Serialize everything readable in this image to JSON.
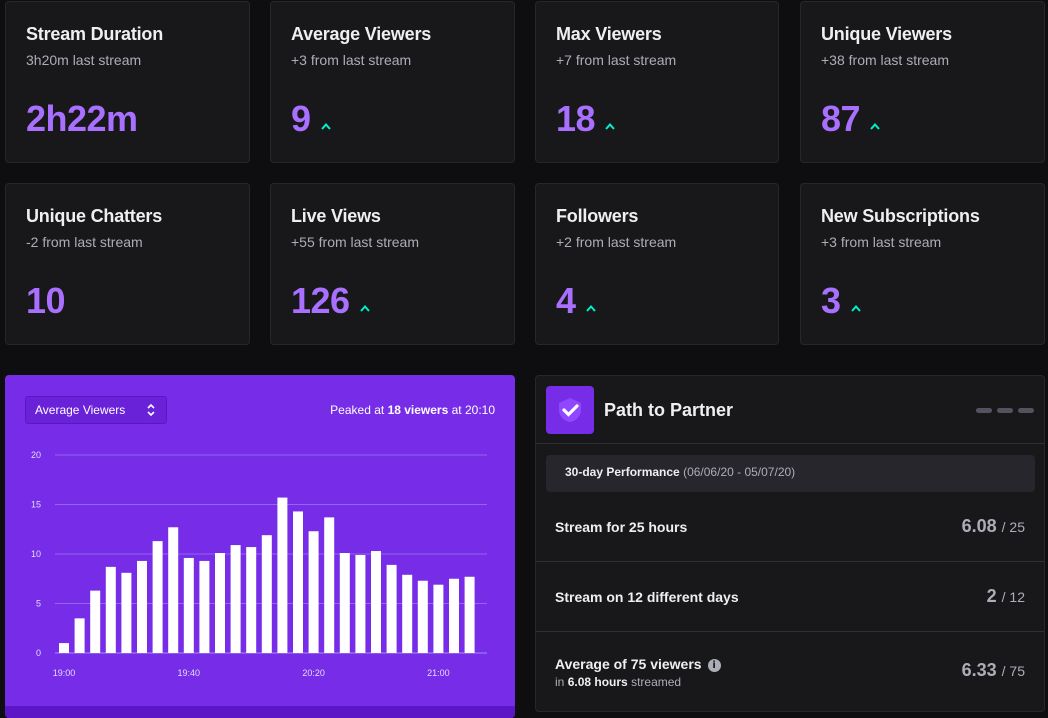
{
  "stats": [
    {
      "title": "Stream Duration",
      "sub": "3h20m last stream",
      "value": "2h22m",
      "up": false
    },
    {
      "title": "Average Viewers",
      "sub": "+3 from last stream",
      "value": "9",
      "up": true
    },
    {
      "title": "Max Viewers",
      "sub": "+7 from last stream",
      "value": "18",
      "up": true
    },
    {
      "title": "Unique Viewers",
      "sub": "+38 from last stream",
      "value": "87",
      "up": true
    },
    {
      "title": "Unique Chatters",
      "sub": "-2 from last stream",
      "value": "10",
      "up": false
    },
    {
      "title": "Live Views",
      "sub": "+55 from last stream",
      "value": "126",
      "up": true
    },
    {
      "title": "Followers",
      "sub": "+2 from last stream",
      "value": "4",
      "up": true
    },
    {
      "title": "New Subscriptions",
      "sub": "+3 from last stream",
      "value": "3",
      "up": true
    }
  ],
  "chart_panel": {
    "select_value": "Average Viewers",
    "peak_prefix": "Peaked at",
    "peak_value": "18 viewers",
    "peak_suffix": "at 20:10"
  },
  "chart_data": {
    "type": "bar",
    "values": [
      1,
      3.5,
      6.3,
      8.7,
      8.1,
      9.3,
      11.3,
      12.7,
      9.6,
      9.3,
      10.1,
      10.9,
      10.7,
      11.9,
      15.7,
      14.3,
      12.3,
      13.7,
      10.1,
      9.9,
      10.3,
      8.9,
      7.9,
      7.3,
      6.9,
      7.5,
      7.7
    ],
    "ylim": [
      0,
      20
    ],
    "yticks": [
      0,
      5,
      10,
      15,
      20
    ],
    "xtick_labels": [
      "19:00",
      "19:40",
      "20:20",
      "21:00"
    ],
    "xtick_positions": [
      0,
      8,
      16,
      24
    ],
    "grid": true
  },
  "partner": {
    "title": "Path to Partner",
    "perf_label": "30-day Performance",
    "perf_range": "(06/06/20 - 05/07/20)",
    "requirements": [
      {
        "label": "Stream for 25 hours",
        "value": "6.08",
        "goal": "/ 25"
      },
      {
        "label": "Stream on 12 different days",
        "value": "2",
        "goal": "/ 12"
      },
      {
        "label": "Average of 75 viewers",
        "sub_prefix": "in",
        "sub_bold": "6.08 hours",
        "sub_suffix": "streamed",
        "value": "6.33",
        "goal": "/ 75"
      }
    ]
  },
  "colors": {
    "accent": "#a970ff",
    "up": "#00f0c8",
    "panel_purple": "#772ce8"
  },
  "icons": {
    "trend": "up-arrow-icon",
    "select": "chevron-updown-icon",
    "badge": "check-icon",
    "info": "info-icon",
    "menu": "more-dots-icon"
  }
}
